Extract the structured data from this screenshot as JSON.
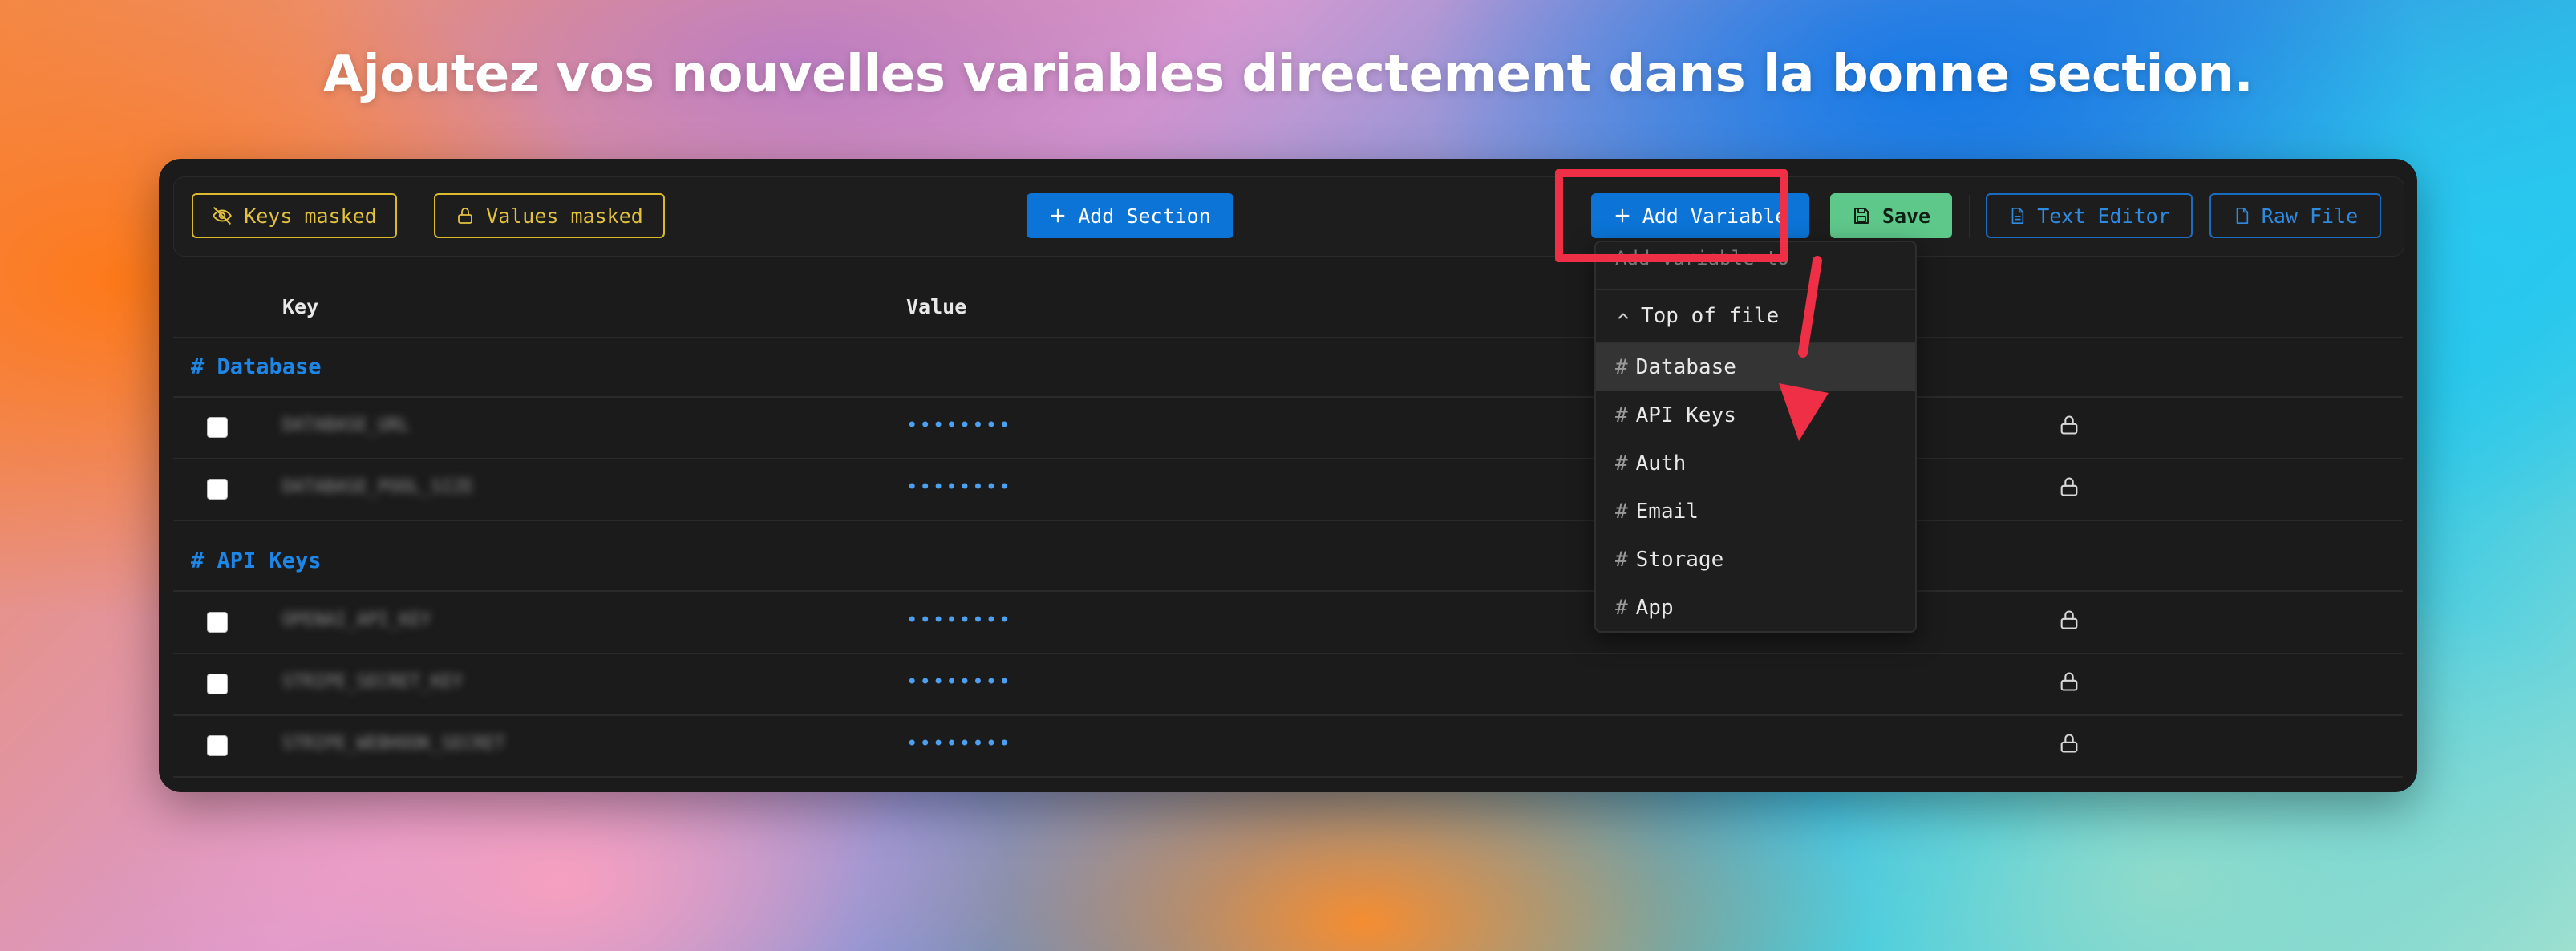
{
  "headline": "Ajoutez vos nouvelles variables directement dans la bonne section.",
  "toolbar": {
    "keys_masked": "Keys masked",
    "values_masked": "Values masked",
    "add_section": "Add Section",
    "add_variable": "Add Variable",
    "save": "Save",
    "text_editor": "Text Editor",
    "raw_file": "Raw File"
  },
  "table": {
    "col_key": "Key",
    "col_value": "Value"
  },
  "sections": [
    {
      "title": "# Database",
      "rows": [
        {
          "key": "DATABASE_URL",
          "value": "••••••••"
        },
        {
          "key": "DATABASE_POOL_SIZE",
          "value": "••••••••"
        }
      ]
    },
    {
      "title": "# API Keys",
      "rows": [
        {
          "key": "OPENAI_API_KEY",
          "value": "••••••••"
        },
        {
          "key": "STRIPE_SECRET_KEY",
          "value": "••••••••"
        },
        {
          "key": "STRIPE_WEBHOOK_SECRET",
          "value": "••••••••"
        }
      ]
    }
  ],
  "dropdown": {
    "heading": "Add variable to",
    "top_of_file": "Top of file",
    "hash": "#",
    "items": [
      "Database",
      "API Keys",
      "Auth",
      "Email",
      "Storage",
      "App"
    ],
    "active_index": 0
  },
  "colors": {
    "accent_blue": "#0b74d6",
    "save_green": "#5ec78a",
    "mask_yellow": "#e3c240",
    "highlight_red": "#ef2f45",
    "section_blue": "#1e86e6"
  }
}
